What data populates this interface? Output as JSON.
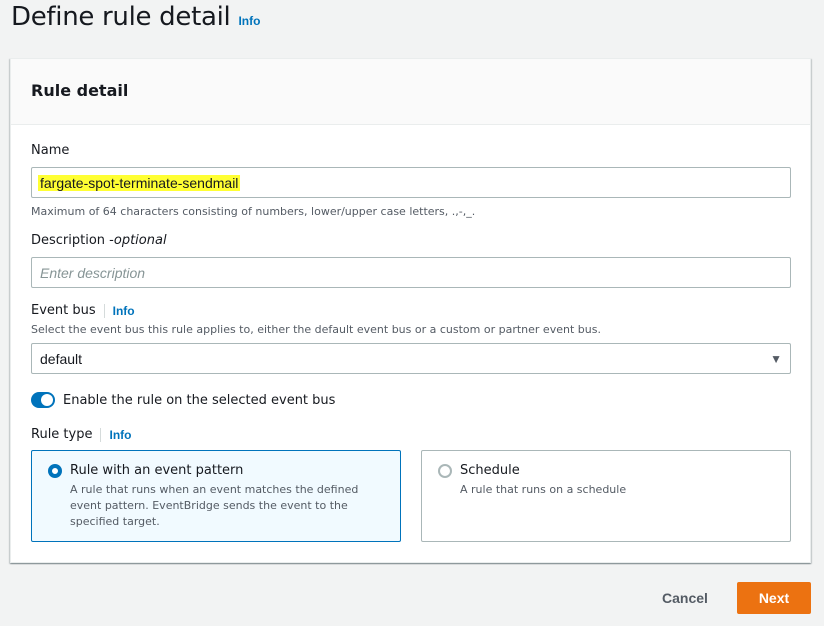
{
  "page": {
    "title": "Define rule detail",
    "info": "Info"
  },
  "container": {
    "title": "Rule detail"
  },
  "name_field": {
    "label": "Name",
    "value": "fargate-spot-terminate-sendmail",
    "help": "Maximum of 64 characters consisting of numbers, lower/upper case letters, .,-,_."
  },
  "description_field": {
    "label": "Description - ",
    "optional": "optional",
    "placeholder": "Enter description"
  },
  "event_bus": {
    "label": "Event bus",
    "info": "Info",
    "help": "Select the event bus this rule applies to, either the default event bus or a custom or partner event bus.",
    "selected": "default"
  },
  "toggle": {
    "label": "Enable the rule on the selected event bus",
    "enabled": true
  },
  "rule_type": {
    "label": "Rule type",
    "info": "Info",
    "options": [
      {
        "title": "Rule with an event pattern",
        "description": "A rule that runs when an event matches the defined event pattern. EventBridge sends the event to the specified target.",
        "selected": true
      },
      {
        "title": "Schedule",
        "description": "A rule that runs on a schedule",
        "selected": false
      }
    ]
  },
  "footer": {
    "cancel": "Cancel",
    "next": "Next"
  },
  "colors": {
    "accent": "#0073bb",
    "primary_button": "#ec7211",
    "highlight": "#ffff33"
  },
  "icons": {
    "select_caret": "caret-down-icon"
  }
}
